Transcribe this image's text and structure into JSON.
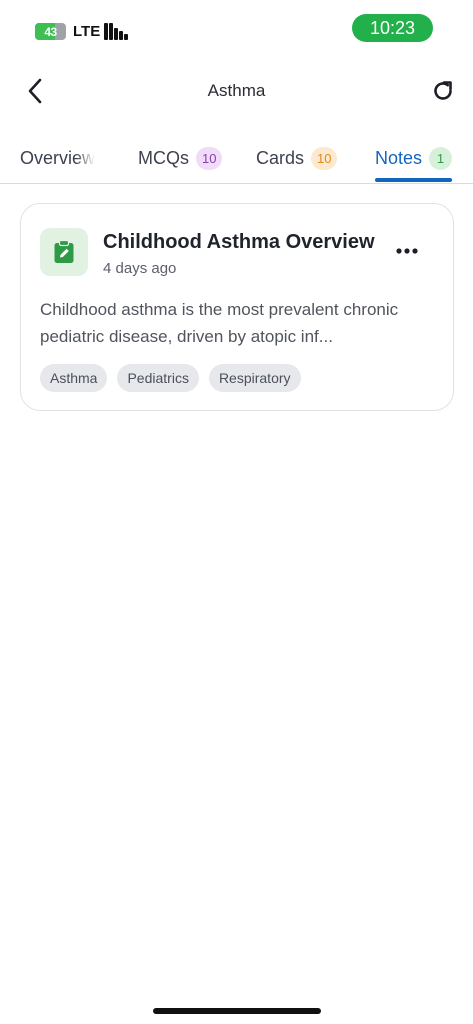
{
  "status_bar": {
    "battery_level": "43",
    "network": "LTE",
    "time": "10:23",
    "battery_color": "#3fbe54",
    "time_pill_color": "#22b04b"
  },
  "header": {
    "title": "Asthma",
    "back_icon": "chevron-left-icon",
    "refresh_icon": "refresh-icon"
  },
  "tabs": [
    {
      "label": "Overview",
      "badge": null,
      "active": false
    },
    {
      "label": "MCQs",
      "badge": "10",
      "badge_color": "#8a3fb0",
      "active": false
    },
    {
      "label": "Cards",
      "badge": "10",
      "badge_color": "#e08a1e",
      "active": false
    },
    {
      "label": "Notes",
      "badge": "1",
      "badge_color": "#2f9a45",
      "active": true
    }
  ],
  "accent_color": "#1565c0",
  "notes": [
    {
      "icon": "clipboard-edit-icon",
      "title": "Childhood Asthma Overview",
      "date": "4 days ago",
      "preview": "Childhood asthma is the most prevalent chronic pediatric disease, driven by atopic inf...",
      "tags": [
        "Asthma",
        "Pediatrics",
        "Respiratory"
      ]
    }
  ]
}
